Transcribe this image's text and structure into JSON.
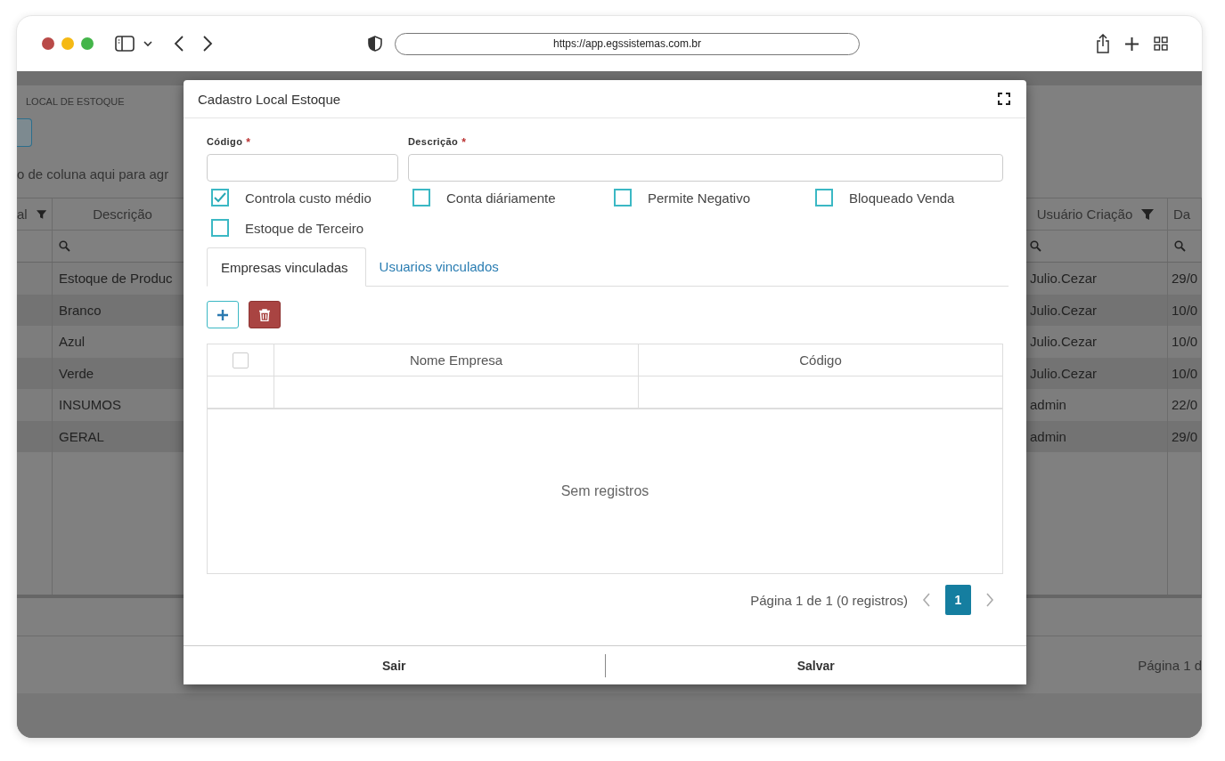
{
  "browser": {
    "url": "https://app.egssistemas.com.br"
  },
  "page": {
    "breadcrumb": "LOCAL DE ESTOQUE",
    "group_hint": "o de coluna aqui para agr",
    "columns": [
      {
        "label": "al",
        "filter": true
      },
      {
        "label": "Descrição",
        "filter": false
      },
      {
        "label": "Usuário Criação",
        "filter": true
      },
      {
        "label": "Da",
        "filter": false
      }
    ],
    "rows": [
      {
        "descricao": "Estoque de Produc",
        "usuario": "Julio.Cezar",
        "data": "29/0"
      },
      {
        "descricao": "Branco",
        "usuario": "Julio.Cezar",
        "data": "10/0"
      },
      {
        "descricao": "Azul",
        "usuario": "Julio.Cezar",
        "data": "10/0"
      },
      {
        "descricao": "Verde",
        "usuario": "Julio.Cezar",
        "data": "10/0"
      },
      {
        "descricao": "INSUMOS",
        "usuario": "admin",
        "data": "22/0"
      },
      {
        "descricao": "GERAL",
        "usuario": "admin",
        "data": "29/0"
      }
    ],
    "pager": "Página 1 d"
  },
  "modal": {
    "title": "Cadastro Local Estoque",
    "fields": [
      {
        "label": "Código",
        "required_mark": "*"
      },
      {
        "label": "Descrição",
        "required_mark": "*"
      }
    ],
    "checkboxes": [
      {
        "label": "Controla custo médio",
        "checked": true
      },
      {
        "label": "Conta diáriamente",
        "checked": false
      },
      {
        "label": "Permite Negativo",
        "checked": false
      },
      {
        "label": "Bloqueado Venda",
        "checked": false
      },
      {
        "label": "Estoque de Terceiro",
        "checked": false
      }
    ],
    "tabs": [
      {
        "label": "Empresas vinculadas",
        "selected": true
      },
      {
        "label": "Usuarios vinculados",
        "selected": false
      }
    ],
    "table": {
      "select_all": false,
      "columns": [
        "Nome Empresa",
        "Código"
      ],
      "empty_text": "Sem registros"
    },
    "pager": {
      "summary": "Página 1 de 1 (0 registros)",
      "pages": [
        {
          "label": "1",
          "selected": true
        }
      ]
    },
    "buttons": [
      "Sair",
      "Salvar"
    ]
  }
}
